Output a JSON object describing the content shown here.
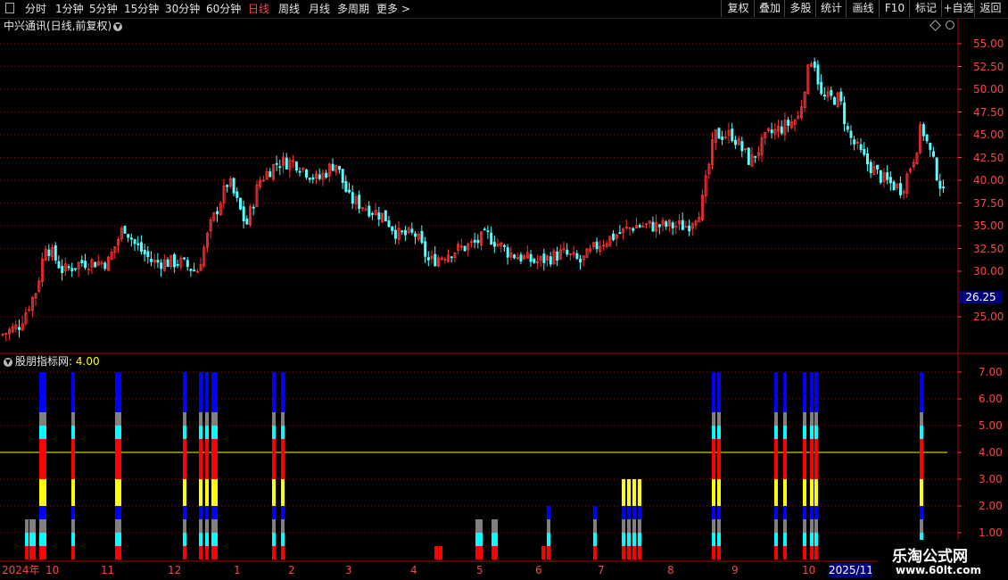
{
  "toolbar": {
    "periods": [
      "分时",
      "1分钟",
      "5分钟",
      "15分钟",
      "30分钟",
      "60分钟",
      "日线",
      "周线",
      "月线",
      "多周期",
      "更多 >"
    ],
    "active_period": "日线",
    "right_buttons": [
      "复权",
      "叠加",
      "多股",
      "统计",
      "画线",
      "F10",
      "标记",
      "+自选",
      "返回"
    ]
  },
  "chart_title": "中兴通讯(日线,前复权)",
  "main_axis": {
    "labels": [
      "55.00",
      "52.50",
      "50.00",
      "47.50",
      "45.00",
      "42.50",
      "40.00",
      "37.50",
      "35.00",
      "32.50",
      "30.00",
      "25.00"
    ],
    "current_price": "26.25"
  },
  "indicator": {
    "name": "股朋指标网",
    "value_label": ": 4.00",
    "axis_labels": [
      "7.00",
      "6.00",
      "5.00",
      "4.00",
      "3.00",
      "2.00",
      "1.00"
    ],
    "ref_line": 4
  },
  "dates": [
    "2024年",
    "10",
    "11",
    "12",
    "1",
    "2",
    "3",
    "4",
    "5",
    "6",
    "7",
    "8",
    "9",
    "10"
  ],
  "date_highlight": "2025/11/",
  "watermark": {
    "title": "乐淘公式网",
    "url": "www.60lt.com"
  },
  "colors": {
    "up": "#ff3232",
    "down": "#54ffff",
    "level_red": "#ff0000",
    "level_yellow": "#ffff00",
    "level_blue": "#0000ff",
    "level_gray": "#808080",
    "level_cyan": "#00ffff"
  },
  "chart_data": {
    "type": "candlestick",
    "title": "中兴通讯(日线,前复权)",
    "ylim": [
      22,
      57
    ],
    "close_path": [
      [
        0,
        23
      ],
      [
        20,
        24
      ],
      [
        40,
        28
      ],
      [
        50,
        33
      ],
      [
        70,
        30
      ],
      [
        90,
        31
      ],
      [
        120,
        31
      ],
      [
        138,
        35
      ],
      [
        150,
        33
      ],
      [
        170,
        31
      ],
      [
        200,
        31
      ],
      [
        220,
        30
      ],
      [
        235,
        35
      ],
      [
        255,
        40
      ],
      [
        275,
        35
      ],
      [
        290,
        40
      ],
      [
        310,
        42
      ],
      [
        330,
        42
      ],
      [
        355,
        40
      ],
      [
        375,
        42
      ],
      [
        390,
        38
      ],
      [
        410,
        37
      ],
      [
        430,
        36
      ],
      [
        445,
        34
      ],
      [
        465,
        34
      ],
      [
        480,
        31
      ],
      [
        500,
        32
      ],
      [
        530,
        33
      ],
      [
        545,
        34
      ],
      [
        570,
        32
      ],
      [
        600,
        31
      ],
      [
        630,
        32
      ],
      [
        650,
        31
      ],
      [
        670,
        33
      ],
      [
        690,
        34
      ],
      [
        710,
        35
      ],
      [
        740,
        35
      ],
      [
        770,
        35
      ],
      [
        785,
        37
      ],
      [
        800,
        45
      ],
      [
        820,
        45
      ],
      [
        840,
        42
      ],
      [
        860,
        45
      ],
      [
        880,
        46
      ],
      [
        895,
        47
      ],
      [
        900,
        50
      ],
      [
        910,
        54
      ],
      [
        920,
        49
      ],
      [
        940,
        49
      ],
      [
        950,
        45
      ],
      [
        970,
        42
      ],
      [
        990,
        40
      ],
      [
        1010,
        39
      ],
      [
        1025,
        43
      ],
      [
        1032,
        46
      ],
      [
        1045,
        42
      ],
      [
        1058,
        38
      ]
    ],
    "indicator": {
      "levels": [
        7,
        6,
        5,
        4,
        3,
        2,
        1
      ],
      "level_colors": [
        "blue",
        "gray",
        "cyan",
        "red",
        "yellow",
        "blue",
        "gray-cyan-red"
      ],
      "bars": [
        [
          28,
          1
        ],
        [
          33,
          1
        ],
        [
          36,
          1
        ],
        [
          44,
          7
        ],
        [
          48,
          7
        ],
        [
          80,
          7
        ],
        [
          129,
          7
        ],
        [
          132,
          7
        ],
        [
          205,
          7
        ],
        [
          223,
          7
        ],
        [
          230,
          7
        ],
        [
          237,
          7
        ],
        [
          240,
          7
        ],
        [
          305,
          7
        ],
        [
          315,
          7
        ],
        [
          487,
          0
        ],
        [
          492,
          0
        ],
        [
          533,
          1
        ],
        [
          537,
          1
        ],
        [
          551,
          1
        ],
        [
          554,
          1
        ],
        [
          607,
          0
        ],
        [
          613,
          2
        ],
        [
          665,
          2
        ],
        [
          697,
          3
        ],
        [
          703,
          3
        ],
        [
          709,
          3
        ],
        [
          715,
          3
        ],
        [
          798,
          7
        ],
        [
          804,
          7
        ],
        [
          868,
          7
        ],
        [
          878,
          7
        ],
        [
          900,
          7
        ],
        [
          908,
          7
        ],
        [
          913,
          7
        ],
        [
          1021,
          0
        ],
        [
          1026,
          0
        ],
        [
          1031,
          7
        ]
      ]
    }
  }
}
